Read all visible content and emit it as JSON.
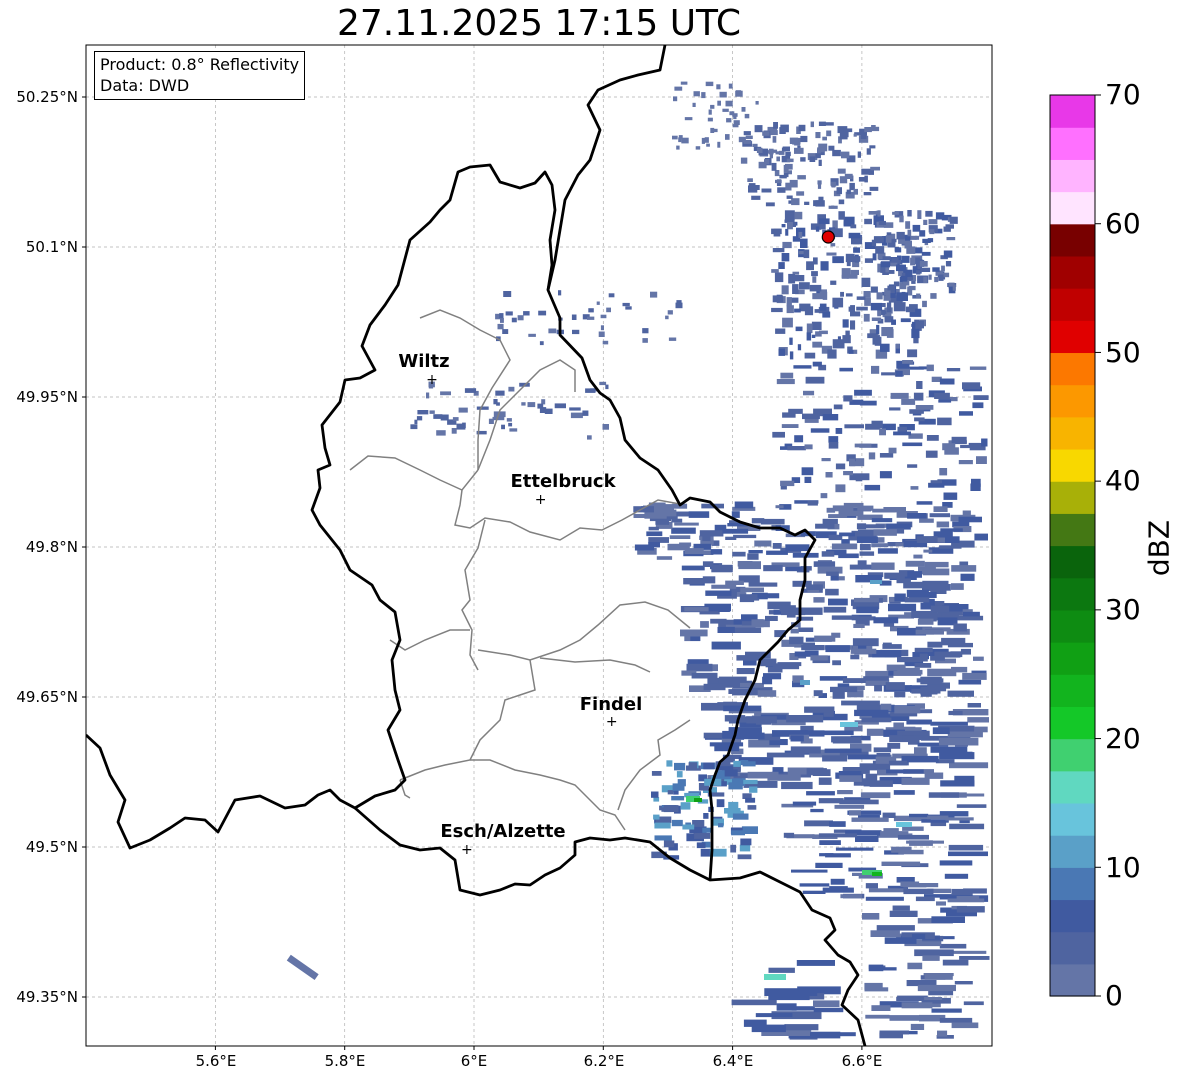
{
  "title": "27.11.2025 17:15 UTC",
  "info": {
    "product": "Product: 0.8° Reflectivity",
    "data_source": "Data: DWD"
  },
  "lat_labels": [
    "50.25°N",
    "50.1°N",
    "49.95°N",
    "49.8°N",
    "49.65°N",
    "49.5°N",
    "49.35°N"
  ],
  "lon_labels": [
    "5.6°E",
    "5.8°E",
    "6°E",
    "6.2°E",
    "6.4°E",
    "6.6°E"
  ],
  "cities": [
    {
      "name": "Wiltz",
      "lon": 5.935,
      "lat": 49.968
    },
    {
      "name": "Ettelbruck",
      "lon": 6.103,
      "lat": 49.848
    },
    {
      "name": "Findel",
      "lon": 6.213,
      "lat": 49.626
    },
    {
      "name": "Esch/Alzette",
      "lon": 5.989,
      "lat": 49.498
    }
  ],
  "radar_site": {
    "lon": 6.548,
    "lat": 50.11,
    "color": "#e00000"
  },
  "colorbar": {
    "label": "dBZ",
    "min": 0,
    "max": 70,
    "step": 5,
    "tick_labels": [
      "0",
      "10",
      "20",
      "30",
      "40",
      "50",
      "60",
      "70"
    ],
    "colors": [
      "#6475a7",
      "#4f64a0",
      "#405aa0",
      "#4a78b4",
      "#5aa0c8",
      "#68c4dc",
      "#60d8c0",
      "#40d070",
      "#14c828",
      "#12b41e",
      "#10a014",
      "#0e8c12",
      "#0c7810",
      "#0a640c",
      "#447814",
      "#a8b008",
      "#f8d800",
      "#f8b400",
      "#fc9800",
      "#fc7800",
      "#e00000",
      "#c00000",
      "#a00000",
      "#780000",
      "#ffe4ff",
      "#ffb4ff",
      "#ff70ff",
      "#e838e8"
    ]
  },
  "map_colors": {
    "country_border": "#000000",
    "canton_border": "#808080",
    "grid": "#b0b0b0"
  }
}
